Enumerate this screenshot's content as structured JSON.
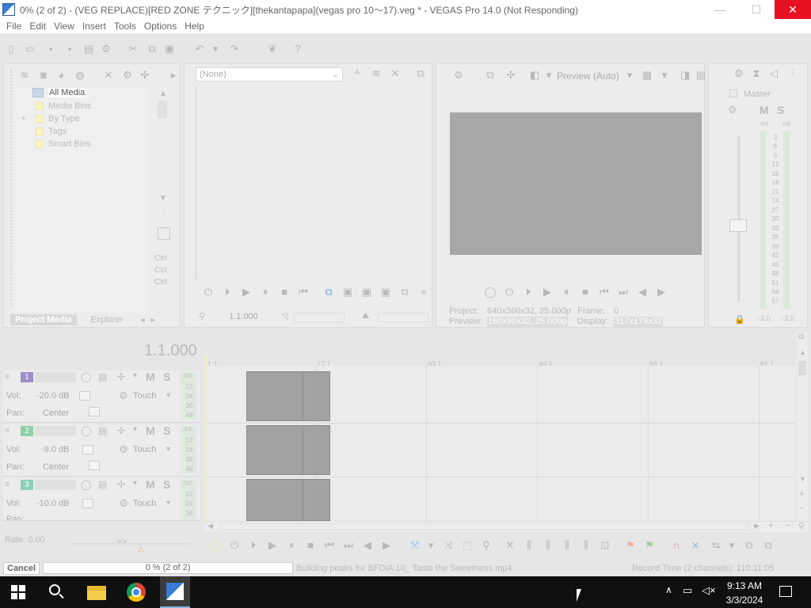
{
  "window": {
    "title": "0% (2 of 2) - (VEG REPLACE)[RED ZONE テクニック][thekantapapa](vegas pro 10〜17).veg * - VEGAS Pro 14.0 (Not Responding)",
    "minimize": "—",
    "maximize": "☐",
    "close": "✕"
  },
  "menu": [
    "File",
    "Edit",
    "View",
    "Insert",
    "Tools",
    "Options",
    "Help"
  ],
  "project_media": {
    "tree": [
      "All Media",
      "Media Bins",
      "By Type",
      "Tags",
      "Smart Bins"
    ],
    "expand": "+",
    "tab_project_media": "Project Media",
    "tab_explorer": "Explorer",
    "ctrl_labels": [
      "Ctrl",
      "Ctrl",
      "Ctrl"
    ],
    "scroll_dots": "· :"
  },
  "trimmer": {
    "dropdown_value": "(None)",
    "timecode": "1.1.000"
  },
  "preview": {
    "mode": "Preview (Auto)",
    "project_label": "Project:",
    "project_value": "640x360x32, 25.000p",
    "frame_label": "Frame:",
    "frame_value": "0",
    "preview_label": "Preview:",
    "preview_value": "160x90x32, 25.000p",
    "display_label": "Display:",
    "display_value": "317x179x32"
  },
  "master": {
    "title": "Master",
    "m": "M",
    "s": "S",
    "top_left": "-Inf.",
    "top_right": "-Inf.",
    "scale": [
      "3",
      "6",
      "9",
      "12",
      "15",
      "18",
      "21",
      "24",
      "27",
      "30",
      "33",
      "36",
      "39",
      "42",
      "45",
      "48",
      "51",
      "54",
      "57"
    ],
    "bottom_left": "-3.0",
    "bottom_right": "-3.0"
  },
  "timeline": {
    "cursor_time": "1.1.000",
    "ruler": [
      "1.1",
      "17.1",
      "33.1",
      "49.1",
      "65.1",
      "81.1"
    ],
    "rate": "Rate: 0.00",
    "tracks": [
      {
        "num": "1",
        "type": "video",
        "color": "#9d8fc7",
        "vol_label": "Vol:",
        "vol": "-20.0 dB",
        "pan_label": "Pan:",
        "pan": "Center",
        "mode": "Touch",
        "m": "M",
        "s": "S",
        "meter": [
          "-Inf.",
          "12",
          "24",
          "36",
          "48"
        ]
      },
      {
        "num": "2",
        "type": "audio",
        "color": "#8fd0a8",
        "vol_label": "Vol:",
        "vol": "-9.0 dB",
        "pan_label": "Pan:",
        "pan": "Center",
        "mode": "Touch",
        "m": "M",
        "s": "S",
        "meter": [
          "-Inf.",
          "12",
          "24",
          "36",
          "48"
        ]
      },
      {
        "num": "3",
        "type": "audio",
        "color": "#8fd0b8",
        "vol_label": "Vol:",
        "vol": "-10.0 dB",
        "pan_label": "Pan:",
        "pan": "",
        "mode": "Touch",
        "m": "M",
        "s": "S",
        "meter": [
          "-Inf.",
          "12",
          "24",
          "36"
        ]
      }
    ]
  },
  "status": {
    "cancel": "Cancel",
    "progress_text": "0 % (2 of 2)",
    "progress": 0,
    "message": "Building peaks for BFDIA 10_ Taste the Sweetness.mp4",
    "record_time": "Record Time (2 channels): 110:11:05"
  },
  "taskbar": {
    "time": "9:13 AM",
    "date": "3/3/2024"
  },
  "colors": {
    "close_button": "#e81123",
    "taskbar": "#101010",
    "clip": "#a2a2a2",
    "accent": "#3a7bd5"
  }
}
